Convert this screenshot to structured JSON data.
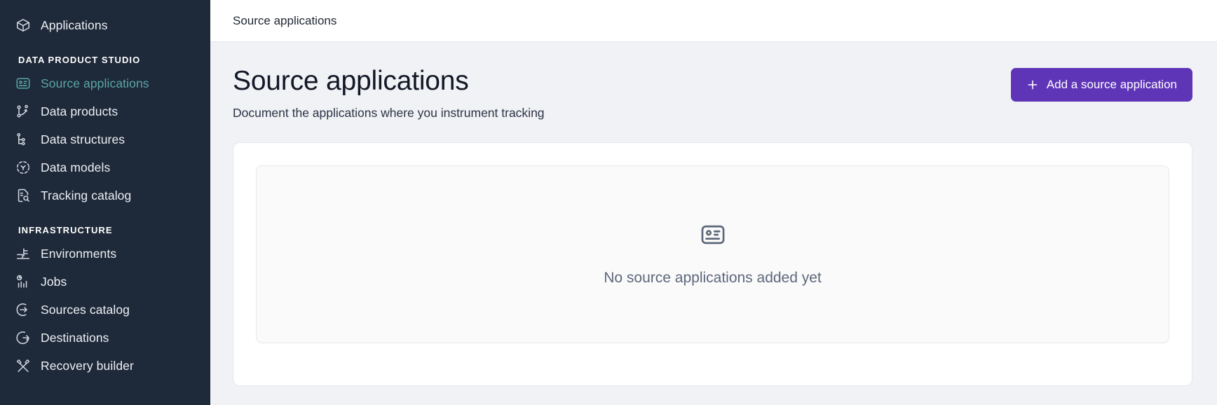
{
  "sidebar": {
    "top_items": [
      {
        "label": "Applications",
        "icon": "cube-icon",
        "active": false
      }
    ],
    "sections": [
      {
        "title": "DATA PRODUCT STUDIO",
        "items": [
          {
            "label": "Source applications",
            "icon": "id-card-icon",
            "active": true
          },
          {
            "label": "Data products",
            "icon": "data-products-icon",
            "active": false
          },
          {
            "label": "Data structures",
            "icon": "data-structures-icon",
            "active": false
          },
          {
            "label": "Data models",
            "icon": "data-models-icon",
            "active": false
          },
          {
            "label": "Tracking catalog",
            "icon": "document-search-icon",
            "active": false
          }
        ]
      },
      {
        "title": "INFRASTRUCTURE",
        "items": [
          {
            "label": "Environments",
            "icon": "environments-icon",
            "active": false
          },
          {
            "label": "Jobs",
            "icon": "jobs-chart-icon",
            "active": false
          },
          {
            "label": "Sources catalog",
            "icon": "arrow-into-circle-icon",
            "active": false
          },
          {
            "label": "Destinations",
            "icon": "arrow-out-of-circle-icon",
            "active": false
          },
          {
            "label": "Recovery builder",
            "icon": "wrench-cross-icon",
            "active": false
          }
        ]
      }
    ],
    "colors": {
      "background": "#1e2939",
      "active": "#5aa6a8",
      "text": "#eef1f5"
    }
  },
  "topbar": {
    "breadcrumb": "Source applications"
  },
  "page": {
    "title": "Source applications",
    "subtitle": "Document the applications where you instrument tracking",
    "primary_button": {
      "label": "Add a source application",
      "icon": "plus-icon",
      "color": "#5f35b8"
    }
  },
  "empty_state": {
    "icon": "id-card-icon",
    "message": "No source applications added yet"
  }
}
